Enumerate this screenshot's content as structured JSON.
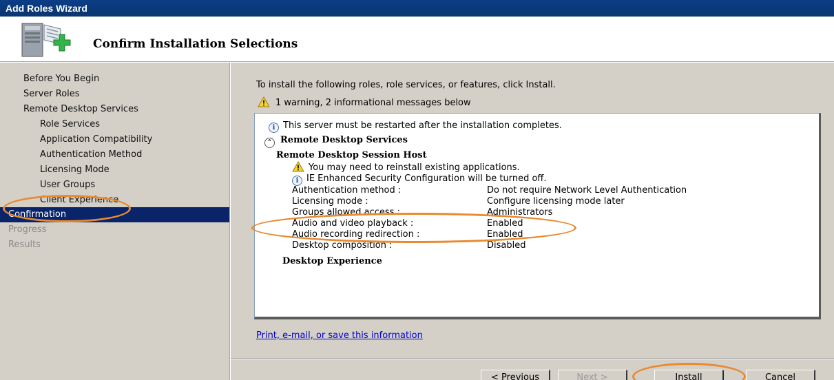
{
  "window": {
    "title": "Add Roles Wizard"
  },
  "header": {
    "title": "Confirm Installation Selections",
    "icon": "server-add-icon"
  },
  "sidebar": {
    "items": [
      {
        "label": "Before You Begin",
        "state": "normal"
      },
      {
        "label": "Server Roles",
        "state": "normal"
      },
      {
        "label": "Remote Desktop Services",
        "state": "normal"
      },
      {
        "label": "Role Services",
        "state": "sub"
      },
      {
        "label": "Application Compatibility",
        "state": "sub"
      },
      {
        "label": "Authentication Method",
        "state": "sub"
      },
      {
        "label": "Licensing Mode",
        "state": "sub"
      },
      {
        "label": "User Groups",
        "state": "sub"
      },
      {
        "label": "Client Experience",
        "state": "sub"
      },
      {
        "label": "Confirmation",
        "state": "active"
      },
      {
        "label": "Progress",
        "state": "disabled"
      },
      {
        "label": "Results",
        "state": "disabled"
      }
    ]
  },
  "main": {
    "intro": "To install the following roles, role services, or features, click Install.",
    "warning_summary": "1 warning, 2 informational messages below",
    "details": {
      "restart_note": "This server must be restarted after the installation completes.",
      "section_title": "Remote Desktop Services",
      "subsection_title": "Remote Desktop Session Host",
      "warning_msg": "You may need to reinstall existing applications.",
      "info_msg": "IE Enhanced Security Configuration will be turned off.",
      "settings": [
        {
          "key": "Authentication method :",
          "value": "Do not require Network Level Authentication"
        },
        {
          "key": "Licensing mode :",
          "value": "Configure licensing mode later"
        },
        {
          "key": "Groups allowed access :",
          "value": "Administrators"
        },
        {
          "key": "Audio and video playback :",
          "value": "Enabled"
        },
        {
          "key": "Audio recording redirection :",
          "value": "Enabled"
        },
        {
          "key": "Desktop composition :",
          "value": "Disabled"
        }
      ],
      "feature_title": "Desktop Experience"
    },
    "link": "Print, e-mail, or save this information"
  },
  "buttons": {
    "previous": "< Previous",
    "next": "Next >",
    "install": "Install",
    "cancel": "Cancel"
  },
  "colors": {
    "title_bar": "#0b3e86",
    "selection": "#0a246a",
    "highlight_annotation": "#e88a30"
  }
}
